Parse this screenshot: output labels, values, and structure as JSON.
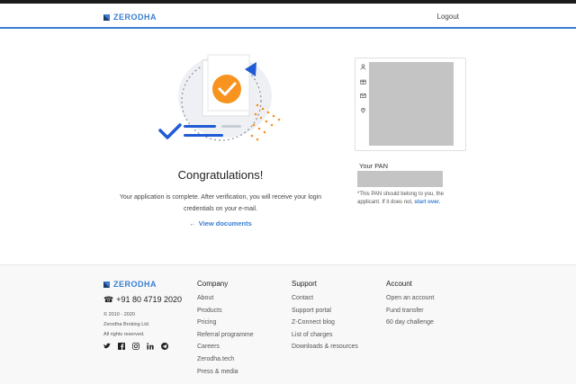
{
  "brand": {
    "name": "ZERODHA",
    "accent": "#387ed1",
    "logo_mark": "zerodha-mark"
  },
  "header": {
    "logout_label": "Logout"
  },
  "success": {
    "title": "Congratulations!",
    "message_line1": "Your application is complete. After verification, you will receive your login",
    "message_line2": "credentials on your e-mail.",
    "view_documents_label": "View documents",
    "view_documents_icon": "arrow-left-icon",
    "illustration": "document-check-illustration",
    "check_color": "#f7931e"
  },
  "profile_card": {
    "icons": [
      "user-icon",
      "gift-icon",
      "mail-icon",
      "location-icon"
    ]
  },
  "pan": {
    "label": "Your PAN",
    "note_text": "*This PAN should belong to you, the applicant. If it does not,",
    "start_over_label": "start over."
  },
  "footer": {
    "phone_icon": "phone-icon",
    "phone": "+91 80 4719 2020",
    "copyright": "© 2010 - 2020",
    "company_name": "Zerodha Broking Ltd.",
    "rights": "All rights reserved.",
    "social_icons": [
      "twitter-icon",
      "facebook-icon",
      "instagram-icon",
      "linkedin-icon",
      "telegram-icon"
    ],
    "columns": [
      {
        "heading": "Company",
        "items": [
          "About",
          "Products",
          "Pricing",
          "Referral programme",
          "Careers",
          "Zerodha.tech",
          "Press & media"
        ]
      },
      {
        "heading": "Support",
        "items": [
          "Contact",
          "Support portal",
          "Z-Connect blog",
          "List of charges",
          "Downloads & resources"
        ]
      },
      {
        "heading": "Account",
        "items": [
          "Open an account",
          "Fund transfer",
          "60 day challenge"
        ]
      }
    ]
  }
}
